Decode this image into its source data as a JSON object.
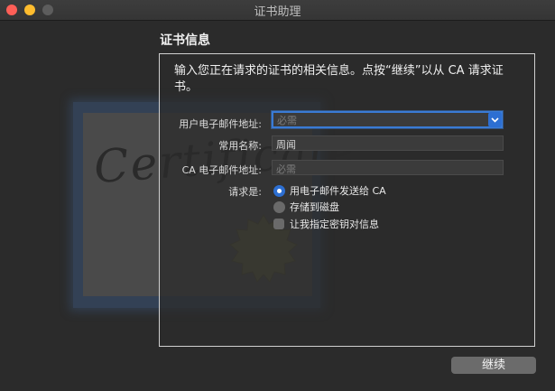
{
  "window": {
    "title": "证书助理"
  },
  "section_title": "证书信息",
  "intro_text": "输入您正在请求的证书的相关信息。点按“继续”以从 CA 请求证书。",
  "artwork": {
    "certificate_word": "Certificate"
  },
  "form": {
    "email": {
      "label": "用户电子邮件地址:",
      "placeholder": "必需",
      "value": ""
    },
    "common_name": {
      "label": "常用名称:",
      "value": "周闻"
    },
    "ca_email": {
      "label": "CA 电子邮件地址:",
      "placeholder": "必需",
      "value": ""
    },
    "request_label": "请求是:",
    "options": {
      "email_to_ca": {
        "label": "用电子邮件发送给 CA",
        "selected": true
      },
      "save_to_disk": {
        "label": "存储到磁盘",
        "selected": false
      },
      "specify_key": {
        "label": "让我指定密钥对信息",
        "checked": false
      }
    }
  },
  "buttons": {
    "continue": "继续"
  },
  "colors": {
    "accent": "#2d6fd2",
    "background": "#2b2b2b",
    "close": "#fe5f57",
    "minimize": "#febc2e"
  }
}
